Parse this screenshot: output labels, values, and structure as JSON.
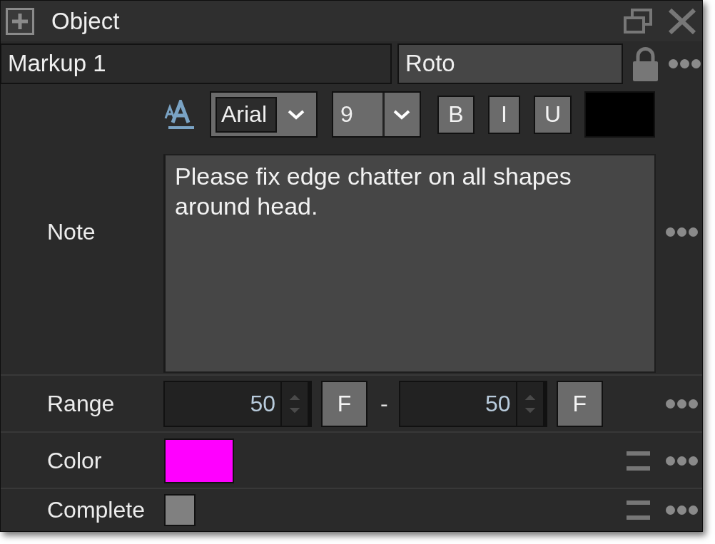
{
  "panel": {
    "title": "Object"
  },
  "header": {
    "name_field": {
      "value": "Markup 1"
    },
    "type_field": {
      "value": "Roto"
    }
  },
  "properties": [
    {
      "kind": "note",
      "label": "Note",
      "font": {
        "value": "Arial"
      },
      "size": {
        "value": "9"
      },
      "style_buttons": [
        "B",
        "I",
        "U"
      ],
      "font_color": {
        "color": "#000000"
      },
      "text": "Please fix edge chatter on all shapes around head."
    },
    {
      "kind": "range",
      "label": "Range",
      "start": {
        "value": "50",
        "button": "F"
      },
      "separator": "-",
      "end": {
        "value": "50",
        "button": "F"
      }
    },
    {
      "kind": "color",
      "label": "Color",
      "color": "#ff00ff"
    },
    {
      "kind": "checkbox",
      "label": "Complete",
      "checked": false
    }
  ]
}
